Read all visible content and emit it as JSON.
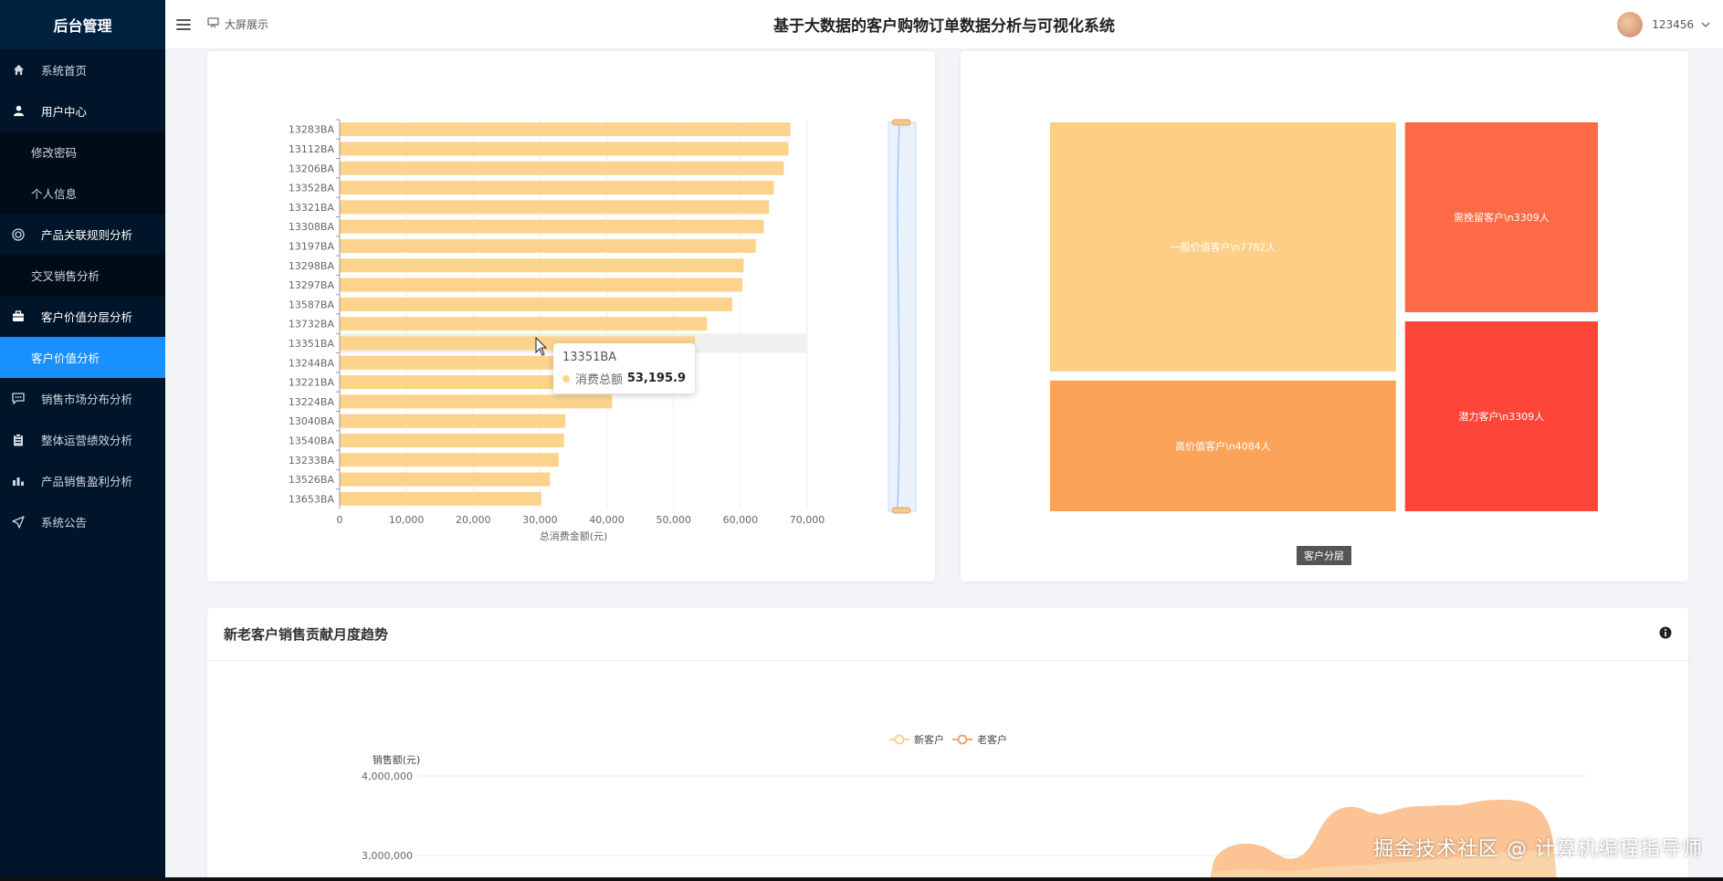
{
  "sidebar": {
    "title": "后台管理",
    "items": [
      {
        "label": "系统首页",
        "icon": "home-icon"
      },
      {
        "label": "用户中心",
        "icon": "user-icon"
      },
      {
        "label": "修改密码"
      },
      {
        "label": "个人信息"
      },
      {
        "label": "产品关联规则分析",
        "icon": "target-icon"
      },
      {
        "label": "交叉销售分析"
      },
      {
        "label": "客户价值分层分析",
        "icon": "briefcase-icon"
      },
      {
        "label": "客户价值分析"
      },
      {
        "label": "销售市场分布分析",
        "icon": "message-icon"
      },
      {
        "label": "整体运营绩效分析",
        "icon": "clipboard-icon"
      },
      {
        "label": "产品销售盈利分析",
        "icon": "chart-icon"
      },
      {
        "label": "系统公告",
        "icon": "send-icon"
      }
    ]
  },
  "header": {
    "bigscreen_label": "大屏展示",
    "title": "基于大数据的客户购物订单数据分析与可视化系统",
    "username": "123456"
  },
  "chart_data": [
    {
      "type": "bar",
      "orientation": "horizontal",
      "categories": [
        "13283BA",
        "13112BA",
        "13206BA",
        "13352BA",
        "13321BA",
        "13308BA",
        "13197BA",
        "13298BA",
        "13297BA",
        "13587BA",
        "13732BA",
        "13351BA",
        "13244BA",
        "13221BA",
        "13224BA",
        "13040BA",
        "13540BA",
        "13233BA",
        "13526BA",
        "13653BA"
      ],
      "series": [
        {
          "name": "消费总额",
          "values": [
            67500,
            67200,
            66500,
            65000,
            64300,
            63500,
            62300,
            60500,
            60300,
            58800,
            55000,
            53195.9,
            48000,
            45000,
            40800,
            33800,
            33600,
            32800,
            31500,
            30200
          ]
        }
      ],
      "xlabel": "总消费金额(元)",
      "xlim": [
        0,
        70000
      ],
      "x_ticks": [
        "0",
        "10,000",
        "20,000",
        "30,000",
        "40,000",
        "50,000",
        "60,000",
        "70,000"
      ],
      "color": "#fcd38c",
      "tooltip": {
        "category": "13351BA",
        "label": "消费总额",
        "value": "53,195.9"
      },
      "datazoom": "vertical slider, right"
    },
    {
      "type": "treemap",
      "title": "客户分层",
      "nodes": [
        {
          "label": "一般价值客户\\n7782人",
          "value": 7782,
          "color": "#fdce85"
        },
        {
          "label": "高价值客户\\n4084人",
          "value": 4084,
          "color": "#fca35a"
        },
        {
          "label": "需挽留客户\\n3309人",
          "value": 3309,
          "color": "#fd6a45"
        },
        {
          "label": "潜力客户\\n3309人",
          "value": 3309,
          "color": "#fd453a"
        }
      ]
    },
    {
      "type": "area",
      "title": "新老客户销售贡献月度趋势",
      "ylabel": "销售额(元)",
      "y_ticks": [
        "4,000,000",
        "3,000,000"
      ],
      "series": [
        {
          "name": "新客户",
          "color": "#fcd38c"
        },
        {
          "name": "老客户",
          "color": "#f5a46c"
        }
      ]
    }
  ],
  "watermark": "掘金技术社区 @ 计算机编程指导师"
}
